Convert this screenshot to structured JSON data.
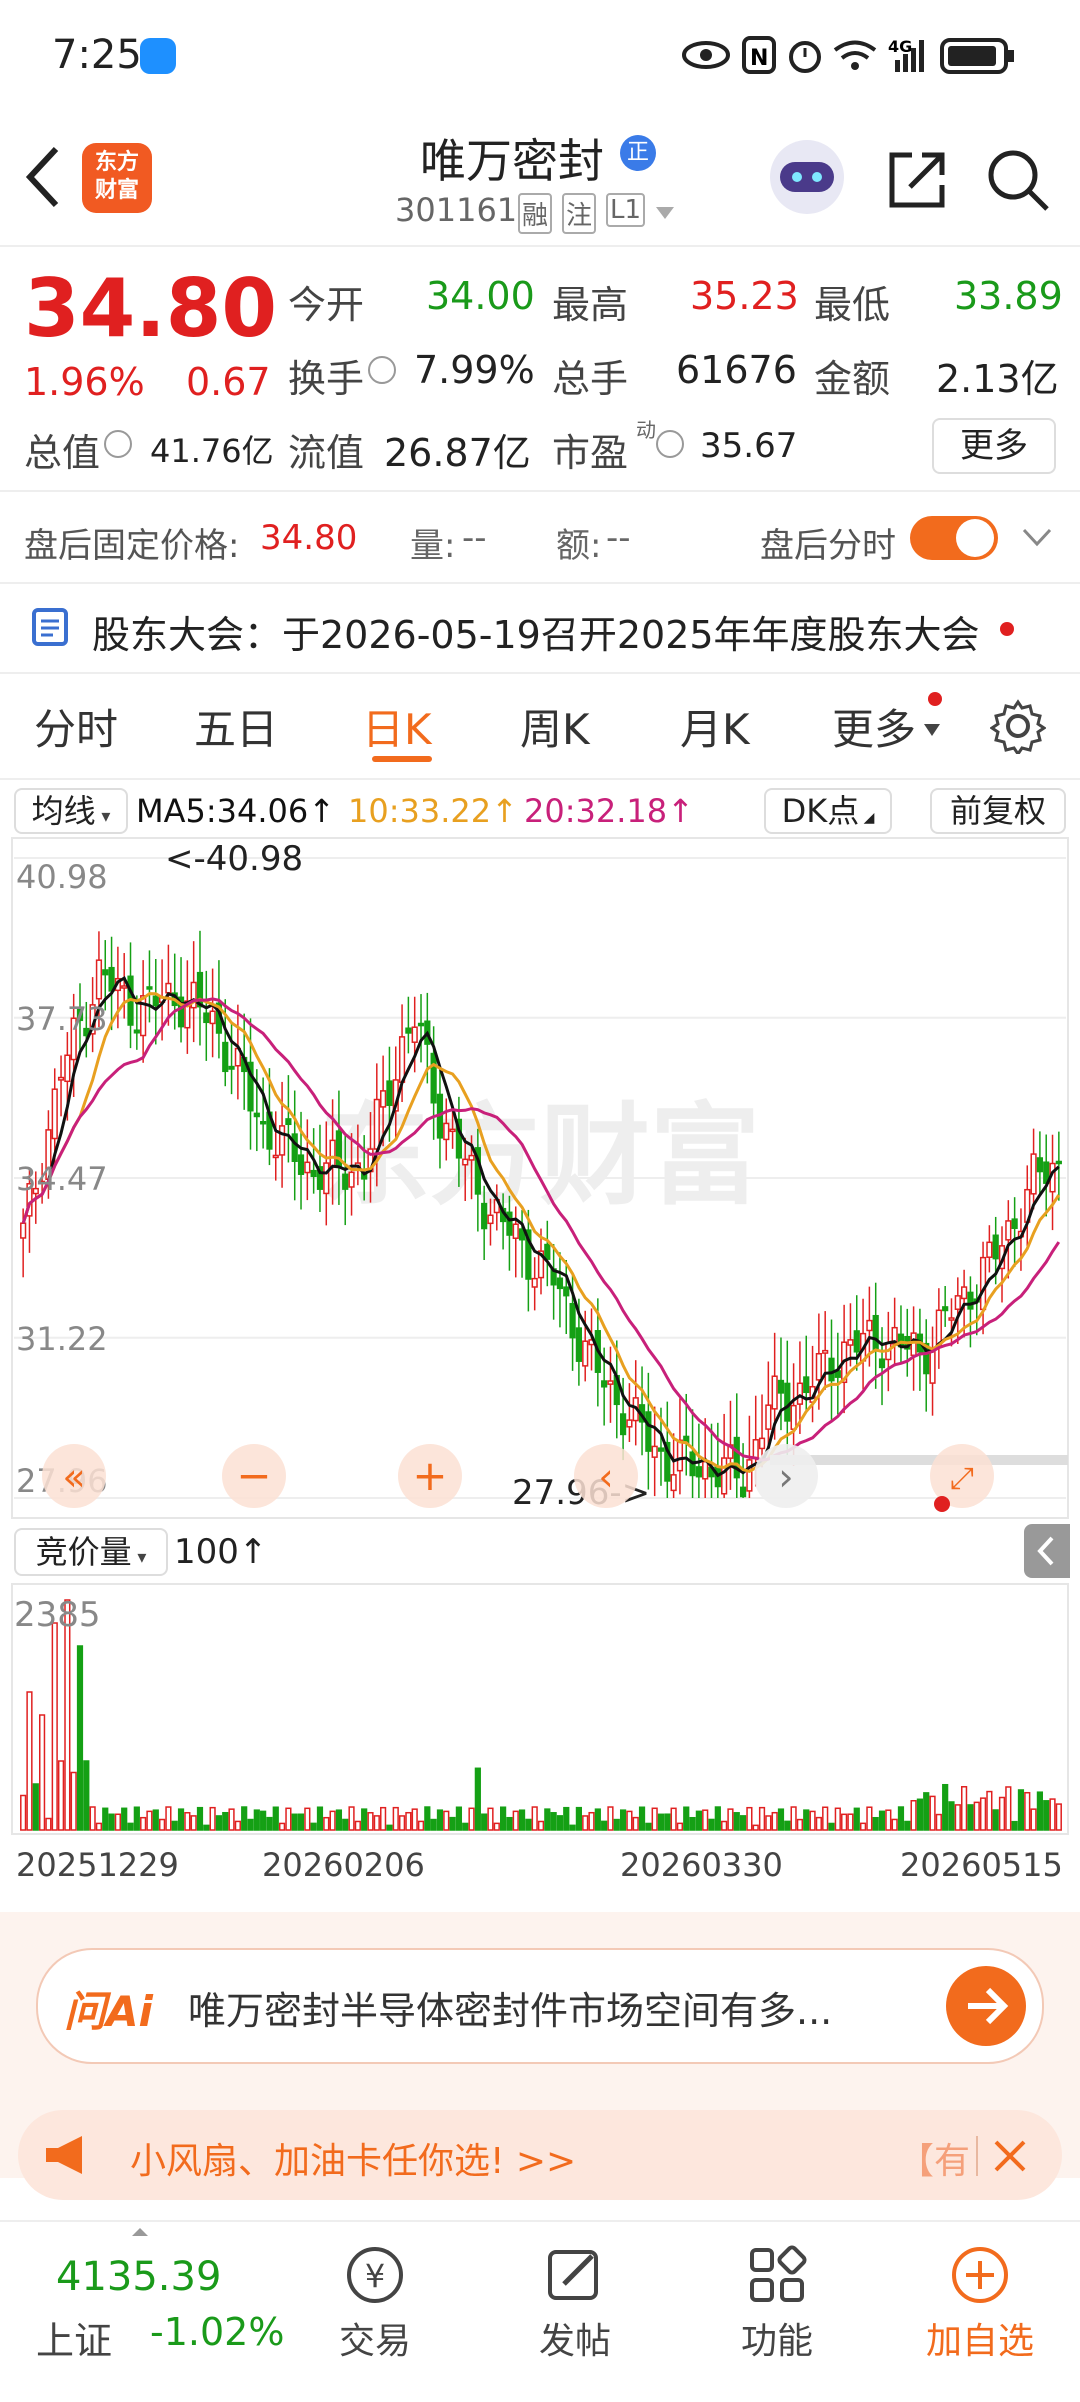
{
  "status_bar": {
    "time": "7:25",
    "network": "4G"
  },
  "header": {
    "brand_line1": "东方",
    "brand_line2": "财富",
    "stock_name": "唯万密封",
    "stock_badge": "正",
    "stock_code": "301161",
    "tag_rong": "融",
    "tag_zhu": "注",
    "tag_level": "L1"
  },
  "quote": {
    "price": "34.80",
    "change_pct": "1.96%",
    "change_amt": "0.67",
    "open_label": "今开",
    "open": "34.00",
    "high_label": "最高",
    "high": "35.23",
    "low_label": "最低",
    "low": "33.89",
    "turnover_label": "换手",
    "turnover": "7.99%",
    "volume_label": "总手",
    "volume": "61676",
    "amount_label": "金额",
    "amount": "2.13亿",
    "mktcap_label": "总值",
    "mktcap": "41.76亿",
    "float_label": "流值",
    "float_cap": "26.87亿",
    "pe_label": "市盈",
    "pe_sup": "动",
    "pe": "35.67",
    "more_button": "更多"
  },
  "after_hours": {
    "label": "盘后固定价格:",
    "price": "34.80",
    "vol_label": "量:",
    "vol": "--",
    "amt_label": "额:",
    "amt": "--",
    "toggle_label": "盘后分时",
    "toggle_on": true
  },
  "notice": {
    "text": "股东大会：于2026-05-19召开2025年年度股东大会"
  },
  "tabs": [
    {
      "label": "分时",
      "active": false
    },
    {
      "label": "五日",
      "active": false
    },
    {
      "label": "日K",
      "active": true
    },
    {
      "label": "周K",
      "active": false
    },
    {
      "label": "月K",
      "active": false
    },
    {
      "label": "更多",
      "active": false
    }
  ],
  "chart_toolbar": {
    "indicator": "均线",
    "ma5": "MA5:34.06↑",
    "ma10": "10:33.22↑",
    "ma20": "20:32.18↑",
    "dk_button": "DK点",
    "adjust_button": "前复权"
  },
  "chart_data": {
    "type": "candlestick",
    "y_ticks": [
      "40.98",
      "37.73",
      "34.47",
      "31.22",
      "27.96"
    ],
    "ylim": [
      27.96,
      40.98
    ],
    "high_annotation": "<-40.98",
    "low_annotation": "27.96->",
    "x_labels": [
      "20251229",
      "20260206",
      "20260330",
      "20260515"
    ],
    "watermark": "东方财富",
    "volume_indicator": "竞价量",
    "volume_period": "100↑",
    "volume_max": "2385",
    "colors": {
      "up": "#e02020",
      "down": "#15a015",
      "ma5": "#111111",
      "ma10": "#e8a020",
      "ma20": "#c8207a"
    }
  },
  "ai_bar": {
    "logo": "问Ai",
    "question": "唯万密封半导体密封件市场空间有多..."
  },
  "promo": {
    "text": "小风扇、加油卡任你选! >>",
    "tail": "【有"
  },
  "bottom_nav": {
    "index_value": "4135.39",
    "index_name": "上证",
    "index_change": "-1.02%",
    "items": [
      {
        "label": "交易"
      },
      {
        "label": "发帖"
      },
      {
        "label": "功能"
      },
      {
        "label": "加自选"
      }
    ]
  }
}
